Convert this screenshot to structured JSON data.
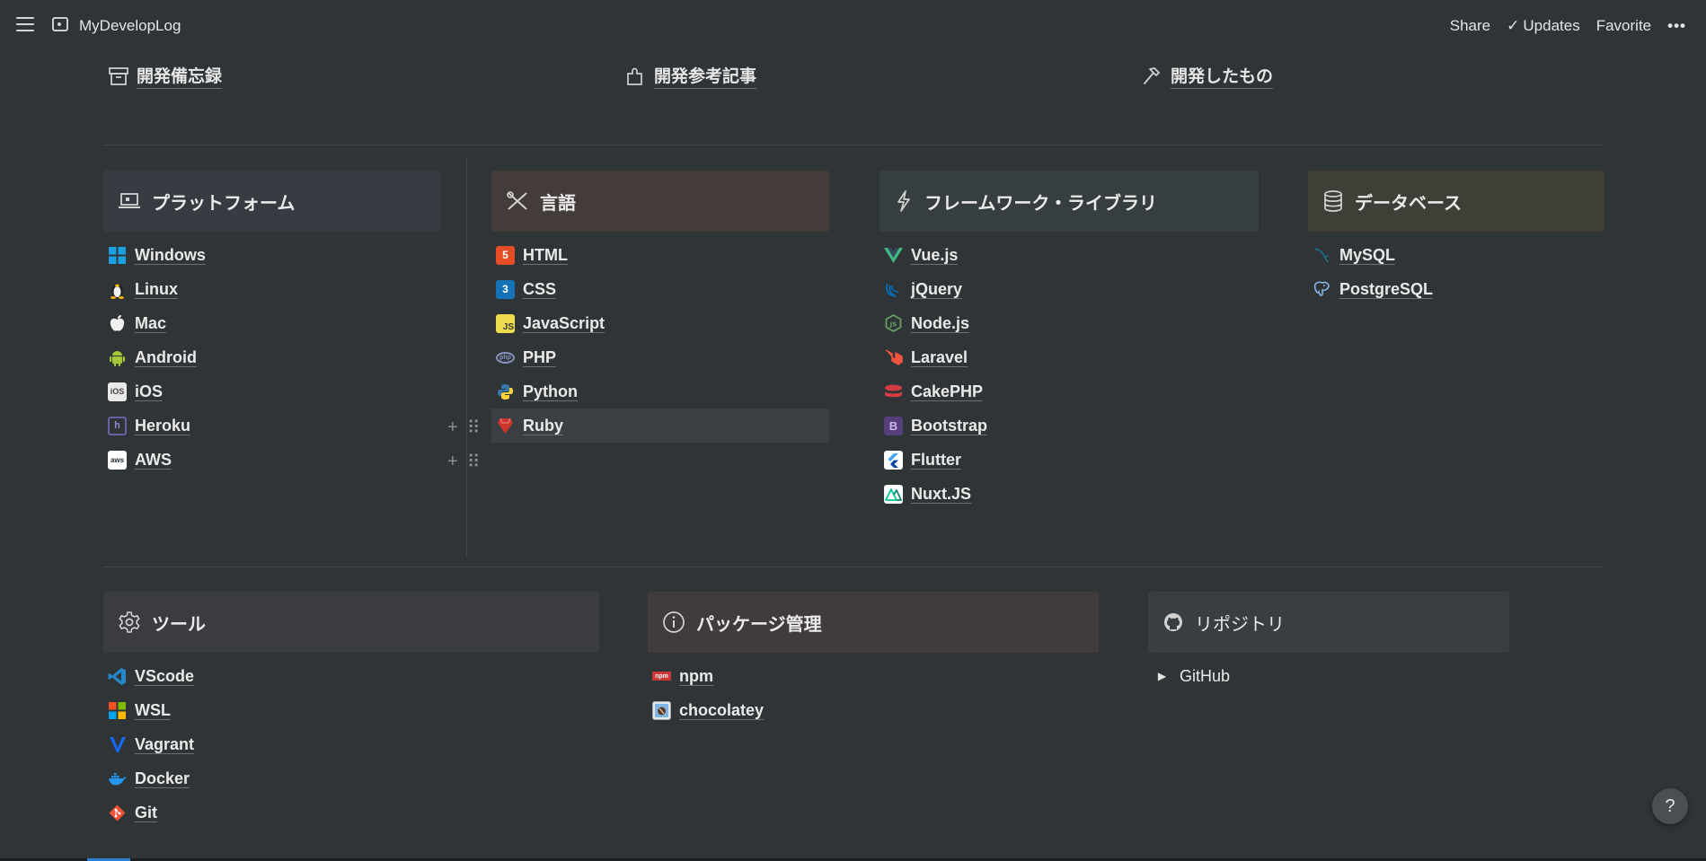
{
  "app": {
    "title": "MyDevelopLog"
  },
  "topbar": {
    "share": "Share",
    "updates": "Updates",
    "favorite": "Favorite",
    "more": "•••"
  },
  "links": [
    {
      "label": "開発備忘録",
      "icon": "archive-box-icon"
    },
    {
      "label": "開発参考記事",
      "icon": "puzzle-icon"
    },
    {
      "label": "開発したもの",
      "icon": "hammer-icon"
    }
  ],
  "sections": {
    "platform": {
      "title": "プラットフォーム",
      "items": [
        "Windows",
        "Linux",
        "Mac",
        "Android",
        "iOS",
        "Heroku",
        "AWS"
      ]
    },
    "language": {
      "title": "言語",
      "items": [
        "HTML",
        "CSS",
        "JavaScript",
        "PHP",
        "Python",
        "Ruby"
      ]
    },
    "framework": {
      "title": "フレームワーク・ライブラリ",
      "items": [
        "Vue.js",
        "jQuery",
        "Node.js",
        "Laravel",
        "CakePHP",
        "Bootstrap",
        "Flutter",
        "Nuxt.JS"
      ]
    },
    "database": {
      "title": "データベース",
      "items": [
        "MySQL",
        "PostgreSQL"
      ]
    },
    "tools": {
      "title": "ツール",
      "items": [
        "VScode",
        "WSL",
        "Vagrant",
        "Docker",
        "Git"
      ]
    },
    "package": {
      "title": "パッケージ管理",
      "items": [
        "npm",
        "chocolatey"
      ]
    },
    "repo": {
      "title": "リポジトリ",
      "toggle": "GitHub"
    }
  },
  "help": {
    "label": "?"
  },
  "colors": {
    "background": "#2f3437",
    "platform_card": "#363c42",
    "language_card": "#433c39",
    "framework_card": "#373e40",
    "database_card": "#3f3e37",
    "tools_card": "#3b3b42",
    "package_card": "#413b3e",
    "repo_card": "#393e42"
  }
}
